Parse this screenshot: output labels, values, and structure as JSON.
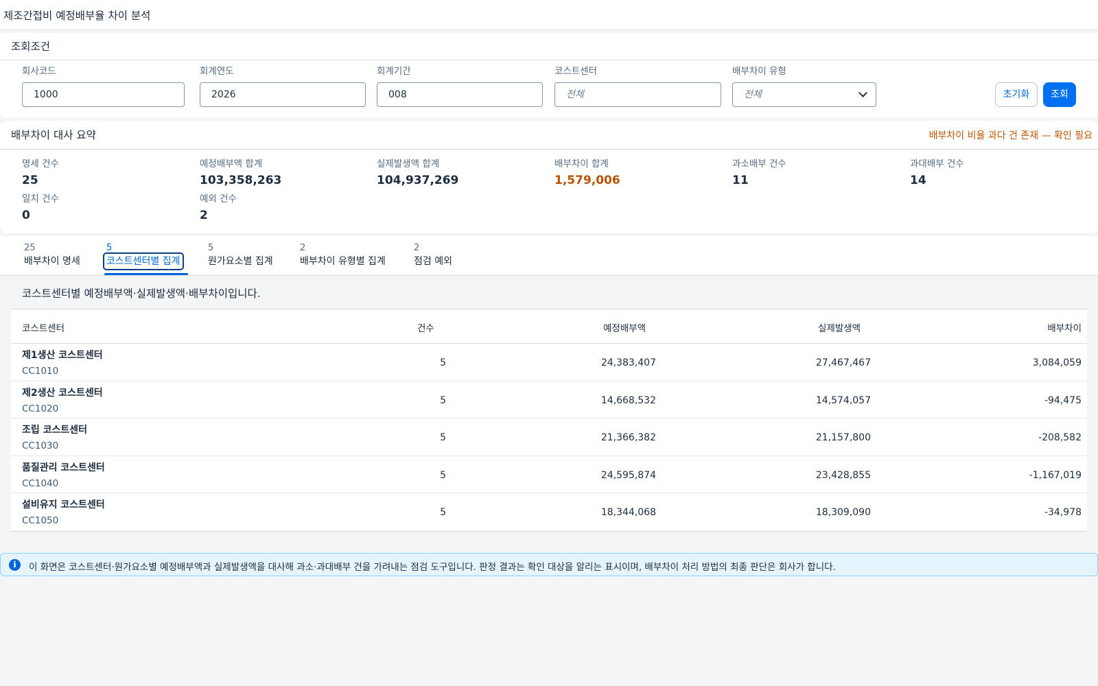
{
  "app": {
    "title": "제조간접비 예정배부율 차이 분석"
  },
  "filters": {
    "title": "조회조건",
    "company_code": {
      "label": "회사코드",
      "value": "1000"
    },
    "fiscal_year": {
      "label": "회계연도",
      "value": "2026"
    },
    "fiscal_period": {
      "label": "회계기간",
      "value": "008"
    },
    "cost_center": {
      "label": "코스트센터",
      "placeholder": "전체"
    },
    "variance_type": {
      "label": "배부차이 유형",
      "selected": "전체"
    },
    "reset_label": "초기화",
    "search_label": "조회"
  },
  "summary": {
    "title": "배부차이 대사 요약",
    "warning": "배부차이 비율 과다 건 존재 — 확인 필요",
    "kpis": [
      {
        "label": "명세 건수",
        "value": "25"
      },
      {
        "label": "예정배부액 합계",
        "value": "103,358,263"
      },
      {
        "label": "실제발생액 합계",
        "value": "104,937,269"
      },
      {
        "label": "배부차이 합계",
        "value": "1,579,006"
      },
      {
        "label": "과소배부 건수",
        "value": "11"
      },
      {
        "label": "과대배부 건수",
        "value": "14"
      },
      {
        "label": "일치 건수",
        "value": "0"
      },
      {
        "label": "예외 건수",
        "value": "2"
      }
    ]
  },
  "tabs": [
    {
      "count": "25",
      "label": "배부차이 명세"
    },
    {
      "count": "5",
      "label": "코스트센터별 집계"
    },
    {
      "count": "5",
      "label": "원가요소별 집계"
    },
    {
      "count": "2",
      "label": "배부차이 유형별 집계"
    },
    {
      "count": "2",
      "label": "점검 예외"
    }
  ],
  "table": {
    "description": "코스트센터별 예정배부액·실제발생액·배부차이입니다.",
    "headers": [
      "코스트센터",
      "건수",
      "예정배부액",
      "실제발생액",
      "배부차이"
    ],
    "rows": [
      {
        "name": "제1생산 코스트센터",
        "code": "CC1010",
        "count": "5",
        "planned": "24,383,407",
        "actual": "27,467,467",
        "variance": "3,084,059"
      },
      {
        "name": "제2생산 코스트센터",
        "code": "CC1020",
        "count": "5",
        "planned": "14,668,532",
        "actual": "14,574,057",
        "variance": "-94,475"
      },
      {
        "name": "조립 코스트센터",
        "code": "CC1030",
        "count": "5",
        "planned": "21,366,382",
        "actual": "21,157,800",
        "variance": "-208,582"
      },
      {
        "name": "품질관리 코스트센터",
        "code": "CC1040",
        "count": "5",
        "planned": "24,595,874",
        "actual": "23,428,855",
        "variance": "-1,167,019"
      },
      {
        "name": "설비유지 코스트센터",
        "code": "CC1050",
        "count": "5",
        "planned": "18,344,068",
        "actual": "18,309,090",
        "variance": "-34,978"
      }
    ]
  },
  "info": {
    "icon": "info-icon",
    "text": "이 화면은 코스트센터·원가요소별 예정배부액과 실제발생액을 대사해 과소·과대배부 건을 가려내는 점검 도구입니다. 판정 결과는 확인 대상을 알리는 표시이며, 배부차이 처리 방법의 최종 판단은 회사가 합니다."
  }
}
